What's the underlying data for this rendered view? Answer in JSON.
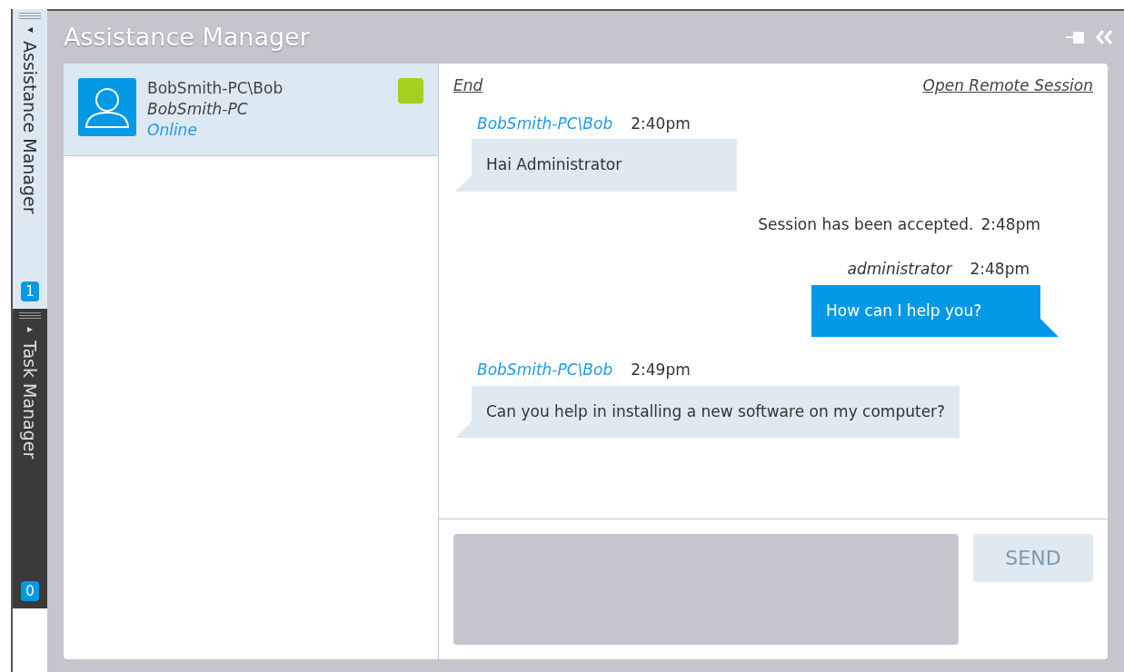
{
  "side_tabs": [
    {
      "label": "Assistance Manager",
      "count": "1",
      "selected": true
    },
    {
      "label": "Task Manager",
      "count": "0",
      "selected": false
    }
  ],
  "window": {
    "title": "Assistance Manager"
  },
  "contacts": [
    {
      "name": "BobSmith-PC\\Bob",
      "computer": "BobSmith-PC",
      "status": "Online",
      "selected": true,
      "color": "#a4d11d"
    }
  ],
  "chat": {
    "links": [
      "End",
      "Open Remote Session"
    ],
    "messages": [
      {
        "kind": "incoming",
        "sender": "BobSmith-PC\\Bob",
        "time": "2:40pm",
        "text": "Hai Administrator"
      },
      {
        "kind": "system",
        "text": "Session has been accepted.",
        "time": "2:48pm"
      },
      {
        "kind": "outgoing",
        "sender": "administrator",
        "time": "2:48pm",
        "text": "How can I help you?"
      },
      {
        "kind": "incoming",
        "sender": "BobSmith-PC\\Bob",
        "time": "2:49pm",
        "text": "Can you help in installing a new software on my computer?"
      }
    ],
    "send_button": "SEND"
  }
}
